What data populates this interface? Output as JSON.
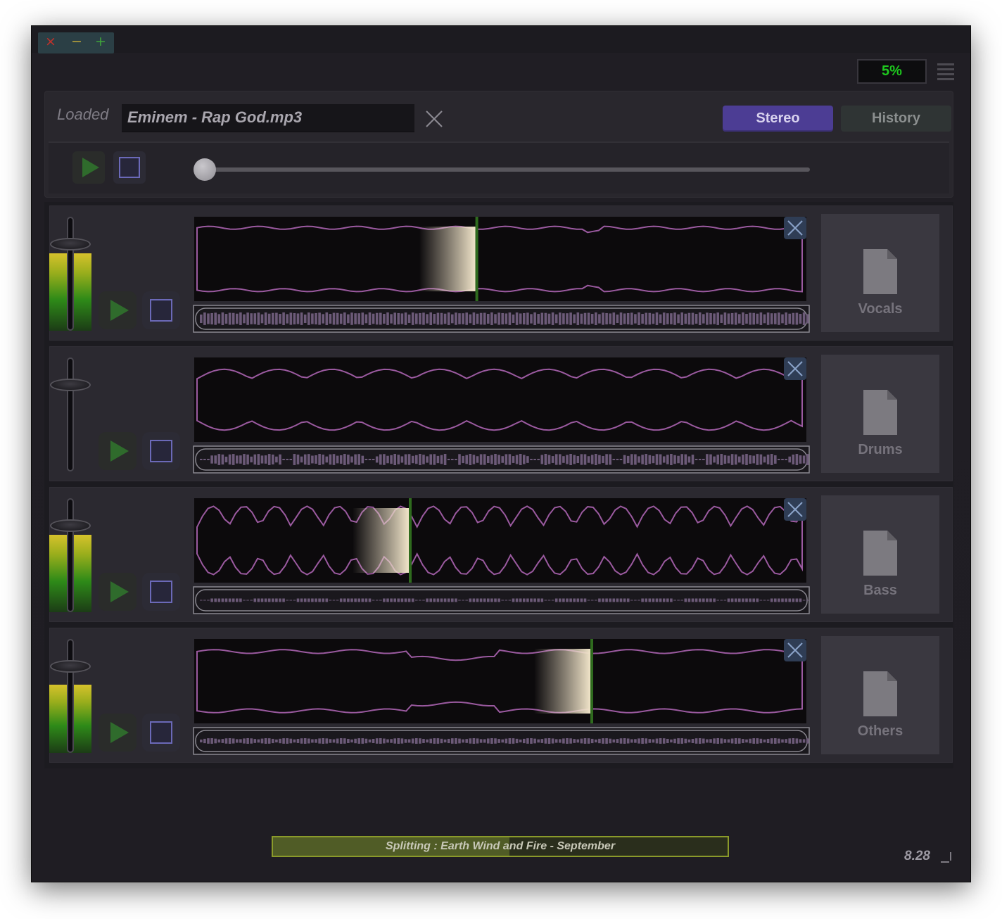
{
  "window": {
    "controls": {
      "close": "×",
      "minimize": "−",
      "maximize": "+"
    },
    "cpu_usage": "5%"
  },
  "loader": {
    "label": "Loaded",
    "filename": "Eminem - Rap God.mp3"
  },
  "tabs": [
    {
      "label": "Stereo",
      "active": true
    },
    {
      "label": "History",
      "active": false
    }
  ],
  "playback": {
    "position": 0.0
  },
  "tracks": [
    {
      "name": "Vocals",
      "level": 0.68,
      "playhead": 0.46
    },
    {
      "name": "Drums",
      "level": 0.0,
      "playhead": null
    },
    {
      "name": "Bass",
      "level": 0.68,
      "playhead": 0.35
    },
    {
      "name": "Others",
      "level": 0.6,
      "playhead": 0.65
    }
  ],
  "status": {
    "text": "Splitting : Earth Wind and Fire - September",
    "progress": 0.52
  },
  "version": "8.28",
  "colors": {
    "accent": "#4c3d94",
    "cpu_text": "#1ec81e",
    "waveform": "#9b5aa0",
    "progress_border": "#8a9a2a"
  }
}
